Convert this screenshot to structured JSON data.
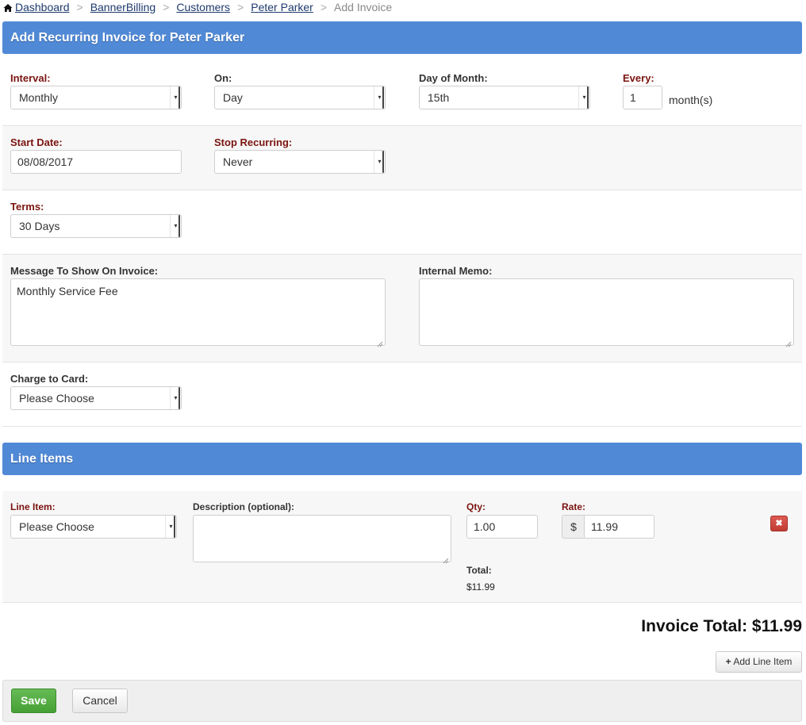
{
  "breadcrumb": {
    "items": [
      "Dashboard",
      "BannerBilling",
      "Customers",
      "Peter Parker"
    ],
    "current": "Add Invoice",
    "separator": ">"
  },
  "header": {
    "title": "Add Recurring Invoice for Peter Parker"
  },
  "schedule": {
    "interval_label": "Interval:",
    "interval_value": "Monthly",
    "on_label": "On:",
    "on_value": "Day",
    "day_of_month_label": "Day of Month:",
    "day_of_month_value": "15th",
    "every_label": "Every:",
    "every_value": "1",
    "every_unit": "month(s)"
  },
  "dates": {
    "start_label": "Start Date:",
    "start_value": "08/08/2017",
    "stop_label": "Stop Recurring:",
    "stop_value": "Never"
  },
  "terms": {
    "label": "Terms:",
    "value": "30 Days"
  },
  "message": {
    "label": "Message To Show On Invoice:",
    "value": "Monthly Service Fee",
    "memo_label": "Internal Memo:",
    "memo_value": ""
  },
  "card": {
    "label": "Charge to Card:",
    "value": "Please Choose"
  },
  "line_items": {
    "title": "Line Items",
    "item_label": "Line Item:",
    "item_value": "Please Choose",
    "description_label": "Description (optional):",
    "description_value": "",
    "qty_label": "Qty:",
    "qty_value": "1.00",
    "rate_label": "Rate:",
    "rate_prefix": "$",
    "rate_value": "11.99",
    "total_label": "Total:",
    "total_value": "$11.99",
    "delete_symbol": "✖"
  },
  "summary": {
    "invoice_total": "Invoice Total: $11.99",
    "add_line_item": "Add Line Item"
  },
  "footer": {
    "save": "Save",
    "cancel": "Cancel"
  },
  "colors": {
    "header_blue": "#5089d6",
    "required_label": "#7a1410",
    "save_green": "#4fa83d",
    "delete_red": "#c9453c"
  }
}
